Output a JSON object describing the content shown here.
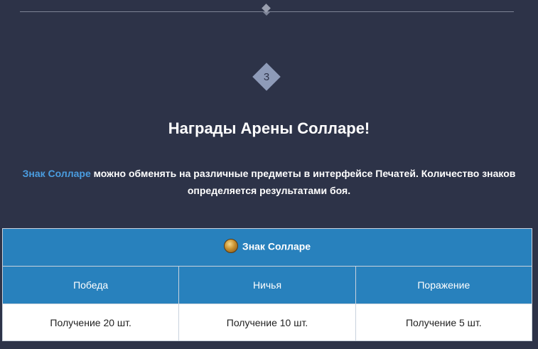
{
  "step": {
    "number": "3"
  },
  "header": {
    "title": "Награды Арены Солларе!"
  },
  "description": {
    "link_text": "Знак Солларе",
    "text": " можно обменять на различные предметы в интерфейсе Печатей. Количество знаков определяется результатами боя."
  },
  "rewards_table": {
    "header": {
      "icon": "coin-icon",
      "label": "Знак Солларе"
    },
    "columns": [
      "Победа",
      "Ничья",
      "Поражение"
    ],
    "values": [
      "Получение 20 шт.",
      "Получение 10 шт.",
      "Получение 5 шт."
    ]
  },
  "colors": {
    "background": "#2d3348",
    "accent": "#2881bd",
    "link": "#4a9de0"
  }
}
